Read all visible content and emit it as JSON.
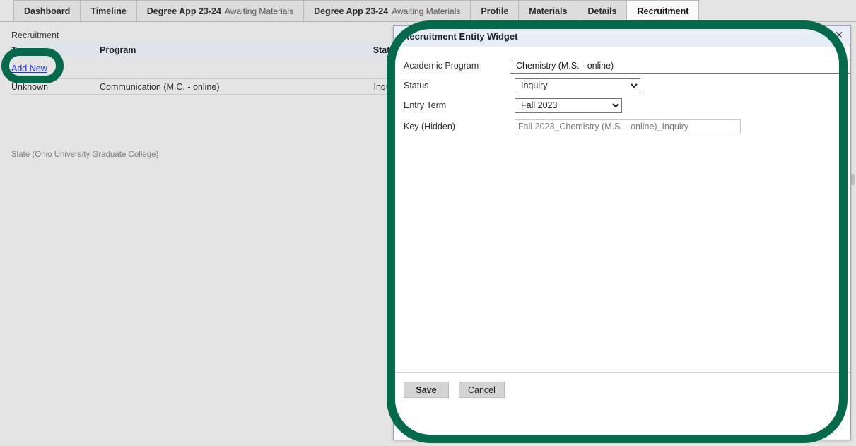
{
  "colors": {
    "annotation_green": "#046a4c",
    "modal_header_bg": "#e8eef7",
    "page_bg": "#e4e4e4",
    "link_blue": "#1a32d8",
    "table_header_bg": "#dfe3ea"
  },
  "tabs": [
    {
      "main": "Dashboard",
      "sub": "",
      "active": false
    },
    {
      "main": "Timeline",
      "sub": "",
      "active": false
    },
    {
      "main": "Degree App 23-24",
      "sub": "Awaiting Materials",
      "active": false
    },
    {
      "main": "Degree App 23-24",
      "sub": "Awaiting Materials",
      "active": false
    },
    {
      "main": "Profile",
      "sub": "",
      "active": false
    },
    {
      "main": "Materials",
      "sub": "",
      "active": false
    },
    {
      "main": "Details",
      "sub": "",
      "active": false
    },
    {
      "main": "Recruitment",
      "sub": "",
      "active": true
    }
  ],
  "page": {
    "section_label": "Recruitment",
    "add_new_label": "Add New",
    "footer": "Slate (Ohio University Graduate College)",
    "table": {
      "headers": {
        "term": "Term",
        "program": "Program",
        "status": "Status"
      },
      "rows": [
        {
          "term": "Unknown",
          "program": "Communication (M.C. - online)",
          "status": "Inquiry"
        }
      ]
    }
  },
  "modal": {
    "title": "Recruitment Entity Widget",
    "close_label": "×",
    "fields": {
      "academic_program": {
        "label": "Academic Program",
        "value": "Chemistry (M.S. - online)"
      },
      "status": {
        "label": "Status",
        "value": "Inquiry"
      },
      "entry_term": {
        "label": "Entry Term",
        "value": "Fall 2023"
      },
      "key_hidden": {
        "label": "Key (Hidden)",
        "value": "Fall 2023_Chemistry (M.S. - online)_Inquiry"
      }
    },
    "buttons": {
      "save": "Save",
      "cancel": "Cancel"
    }
  }
}
